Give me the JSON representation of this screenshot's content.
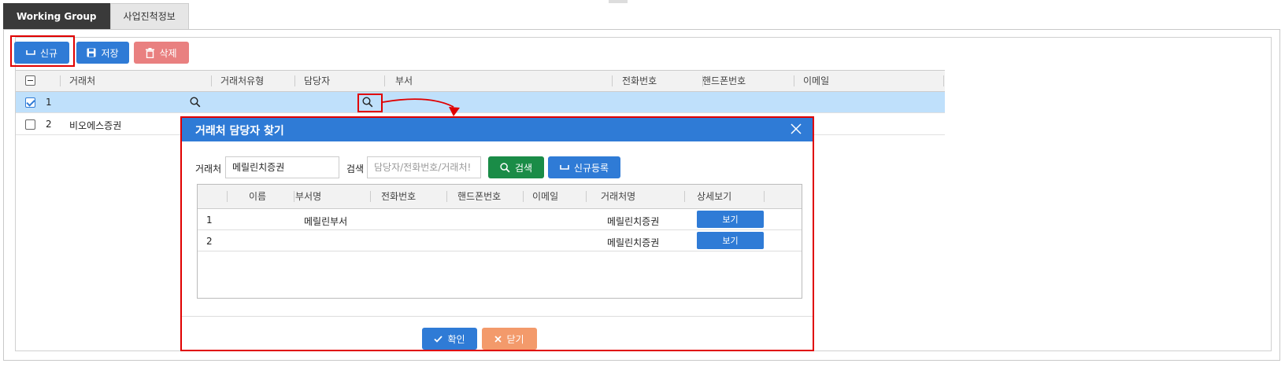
{
  "tabs": [
    {
      "label": "Working Group",
      "active": true
    },
    {
      "label": "사업진척정보",
      "active": false
    }
  ],
  "toolbar": {
    "new_label": "신규",
    "save_label": "저장",
    "delete_label": "삭제"
  },
  "grid": {
    "columns": [
      "거래처",
      "거래처유형",
      "담당자",
      "부서",
      "전화번호",
      "핸드폰번호",
      "이메일"
    ],
    "rows": [
      {
        "num": "1",
        "client": "",
        "checked": true
      },
      {
        "num": "2",
        "client": "비오에스증권",
        "checked": false
      }
    ]
  },
  "dialog": {
    "title": "거래처 담당자 찾기",
    "client_label": "거래처",
    "client_value": "메릴린치증권",
    "search_label": "검색",
    "search_placeholder": "담당자/전화번호/거래처!",
    "search_button": "검색",
    "register_button": "신규등록",
    "columns": [
      "이름",
      "부서명",
      "전화번호",
      "핸드폰번호",
      "이메일",
      "거래처명",
      "상세보기"
    ],
    "rows": [
      {
        "num": "1",
        "name": "",
        "dept": "메릴린부서",
        "phone": "",
        "mobile": "",
        "email": "",
        "client": "메릴린치증권",
        "view": "보기"
      },
      {
        "num": "2",
        "name": "",
        "dept": "",
        "phone": "",
        "mobile": "",
        "email": "",
        "client": "메릴린치증권",
        "view": "보기"
      }
    ],
    "confirm_button": "확인",
    "close_button": "닫기"
  },
  "colors": {
    "primary": "#2f7bd6",
    "danger_light": "#e98080",
    "success": "#1a8c47",
    "warning_light": "#f39a6b",
    "selected_row": "#bfe0fb",
    "highlight": "#e00000"
  }
}
